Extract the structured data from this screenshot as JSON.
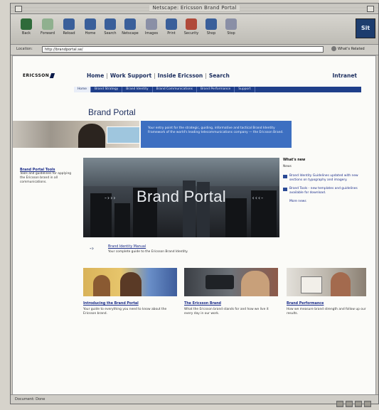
{
  "window": {
    "title": "Netscape: Ericsson Brand Portal"
  },
  "toolbar": {
    "buttons": [
      {
        "label": "Back",
        "icon": "back-icon",
        "color": "#2f6b3a"
      },
      {
        "label": "Forward",
        "icon": "forward-icon",
        "color": "#8fb08f"
      },
      {
        "label": "Reload",
        "icon": "reload-icon",
        "color": "#3a5f9a"
      },
      {
        "label": "Home",
        "icon": "home-icon",
        "color": "#3a5f9a"
      },
      {
        "label": "Search",
        "icon": "search-icon",
        "color": "#3a5f9a"
      },
      {
        "label": "Netscape",
        "icon": "netscape-icon",
        "color": "#3a5f9a"
      },
      {
        "label": "Images",
        "icon": "images-icon",
        "color": "#8a8fa6"
      },
      {
        "label": "Print",
        "icon": "print-icon",
        "color": "#3a5f9a"
      },
      {
        "label": "Security",
        "icon": "security-icon",
        "color": "#b04a3a"
      },
      {
        "label": "Shop",
        "icon": "shop-icon",
        "color": "#3a5f9a"
      },
      {
        "label": "Stop",
        "icon": "stop-icon",
        "color": "#8a8fa6"
      }
    ],
    "brand_logo": "Sit"
  },
  "location": {
    "label": "Location:",
    "url": "http://brandportal.se/",
    "related_label": "What's Related"
  },
  "site": {
    "logo": "ERICSSON",
    "nav": [
      "Home",
      "Work Support",
      "Inside Ericsson",
      "Search"
    ],
    "intranet": "Intranet",
    "subnav": [
      "Home",
      "Brand Strategy",
      "Brand Identity",
      "Brand Communications",
      "Brand Performance",
      "Support"
    ],
    "page_title": "Brand Portal",
    "hero_text": "Your entry point for the strategic, guiding, informative and tactical Brand Identity Framework of the world's leading telecommunications company — the Ericsson Brand.",
    "left_link": {
      "title": "Brand Portal Tools",
      "desc": "Tools and guidelines for applying the Ericsson brand in all communications."
    },
    "banner_text": "Brand Portal",
    "right": {
      "heading": "What's new",
      "sub": "News",
      "items": [
        "Brand Identity Guidelines updated with new sections on typography and imagery.",
        "Brand Tools - new templates and guidelines available for download."
      ],
      "more": "More news"
    },
    "feature": {
      "title": "Brand Identity Manual",
      "desc": "Your complete guide to the Ericsson Brand Identity."
    },
    "cards": [
      {
        "title": "Introducing the Brand Portal",
        "desc": "Your guide to everything you need to know about the Ericsson brand."
      },
      {
        "title": "The Ericsson Brand",
        "desc": "What the Ericsson brand stands for and how we live it every day in our work."
      },
      {
        "title": "Brand Performance",
        "desc": "How we measure brand strength and follow up our results."
      }
    ]
  },
  "status": {
    "text": "Document: Done"
  }
}
